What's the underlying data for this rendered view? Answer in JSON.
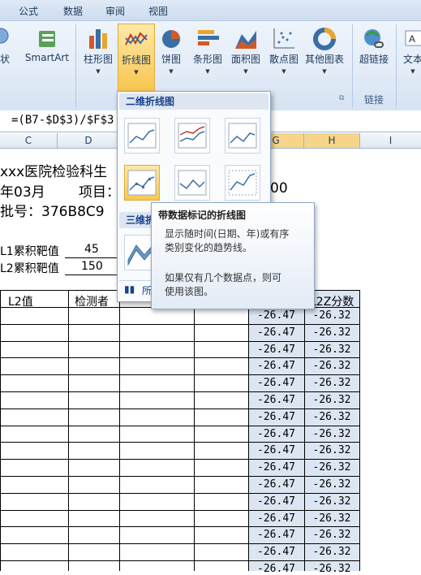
{
  "ribbon_tabs": [
    "公式",
    "数据",
    "审阅",
    "视图"
  ],
  "ribbon": {
    "buttons": [
      {
        "label": "状",
        "icon": "shapes-icon"
      },
      {
        "label": "SmartArt",
        "icon": "smartart-icon"
      },
      {
        "label": "柱形图",
        "icon": "column-chart-icon"
      },
      {
        "label": "折线图",
        "icon": "line-chart-icon"
      },
      {
        "label": "饼图",
        "icon": "pie-chart-icon"
      },
      {
        "label": "条形图",
        "icon": "bar-chart-icon"
      },
      {
        "label": "面积图",
        "icon": "area-chart-icon"
      },
      {
        "label": "散点图",
        "icon": "scatter-chart-icon"
      },
      {
        "label": "其他图表",
        "icon": "other-charts-icon"
      },
      {
        "label": "超链接",
        "icon": "hyperlink-icon"
      },
      {
        "label": "文本",
        "icon": "text-icon"
      }
    ],
    "groups": {
      "links": "链接"
    }
  },
  "formula_bar": {
    "formula": "=(B7-$D$3)/$F$3"
  },
  "columns": [
    "C",
    "D",
    "G",
    "H",
    "I"
  ],
  "sheet": {
    "title": "xxx医院检验科生",
    "month": "年03月",
    "project_label": "项目：A",
    "value_00": "00",
    "batch": "批号：376B8C9",
    "l1_label": "L1累积靶值",
    "l1_value": "45",
    "l2_label": "L2累积靶值",
    "l2_value": "150",
    "header_l2": "L2值",
    "header_tester": "检测者",
    "header_l2z": "L2Z分数",
    "rows": [
      {
        "g": "-26.47",
        "h": "-26.32"
      },
      {
        "g": "-26.47",
        "h": "-26.32"
      },
      {
        "g": "-26.47",
        "h": "-26.32"
      },
      {
        "g": "-26.47",
        "h": "-26.32"
      },
      {
        "g": "-26.47",
        "h": "-26.32"
      },
      {
        "g": "-26.47",
        "h": "-26.32"
      },
      {
        "g": "-26.47",
        "h": "-26.32"
      },
      {
        "g": "-26.47",
        "h": "-26.32"
      },
      {
        "g": "-26.47",
        "h": "-26.32"
      },
      {
        "g": "-26.47",
        "h": "-26.32"
      },
      {
        "g": "-26.47",
        "h": "-26.32"
      },
      {
        "g": "-26.47",
        "h": "-26.32"
      },
      {
        "g": "-26.47",
        "h": "-26.32"
      },
      {
        "g": "-26.47",
        "h": "-26.32"
      },
      {
        "g": "-26.47",
        "h": "-26.32"
      },
      {
        "g": "-26.47",
        "h": "-26.32"
      }
    ]
  },
  "gallery": {
    "section_2d": "二维折线图",
    "section_3d": "三维折",
    "footer_label": "所"
  },
  "tooltip": {
    "title": "带数据标记的折线图",
    "line1": "显示随时间(日期、年)或有序",
    "line2": "类别变化的趋势线。",
    "line3": "如果仅有几个数据点，则可",
    "line4": "使用该图。"
  },
  "colors": {
    "ribbon_text": "#1e395b",
    "selected": "#f9c84f",
    "accent": "#15428b"
  }
}
